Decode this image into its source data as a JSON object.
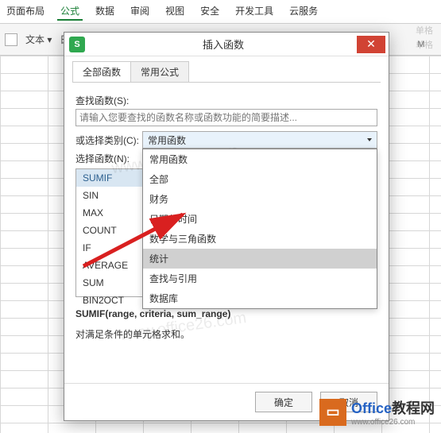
{
  "ribbon": {
    "tabs": [
      "页面布局",
      "公式",
      "数据",
      "审阅",
      "视图",
      "安全",
      "开发工具",
      "云服务"
    ],
    "active": 1,
    "group1": "文本 ▾",
    "group2": "日期和时间 ▾"
  },
  "bg_labels": [
    "单格",
    "单格"
  ],
  "col_header": "M",
  "dialog": {
    "title": "插入函数",
    "icon_letter": "S",
    "tabs": {
      "all": "全部函数",
      "common": "常用公式"
    },
    "search_label": "查找函数(S):",
    "search_placeholder": "请输入您要查找的函数名称或函数功能的简要描述...",
    "category_label": "或选择类别(C):",
    "category_value": "常用函数",
    "dropdown_items": [
      "常用函数",
      "全部",
      "财务",
      "日期与时间",
      "数学与三角函数",
      "统计",
      "查找与引用",
      "数据库"
    ],
    "dropdown_hover_index": 5,
    "select_label": "选择函数(N):",
    "functions": [
      "SUMIF",
      "SIN",
      "MAX",
      "COUNT",
      "IF",
      "AVERAGE",
      "SUM",
      "BIN2OCT"
    ],
    "selected_index": 0,
    "desc_sig": "SUMIF(range, criteria, sum_range)",
    "desc_text": "对满足条件的单元格求和。",
    "ok": "确定",
    "cancel": "取消"
  },
  "logo": {
    "main1": "Office",
    "main2": "教程网",
    "sub": "www.office26.com"
  },
  "watermark": "www.office26.com"
}
